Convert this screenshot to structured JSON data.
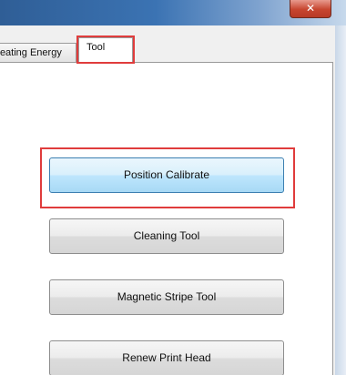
{
  "window": {
    "close_glyph": "✕"
  },
  "tabs": {
    "prev_label": "Heating Energy",
    "active_label": "Tool"
  },
  "buttons": {
    "position_calibrate": "Position Calibrate",
    "cleaning_tool": "Cleaning Tool",
    "magnetic_stripe_tool": "Magnetic Stripe Tool",
    "renew_print_head": "Renew Print Head"
  },
  "colors": {
    "highlight": "#e03c3c",
    "titlebar": "#3b73b3"
  }
}
